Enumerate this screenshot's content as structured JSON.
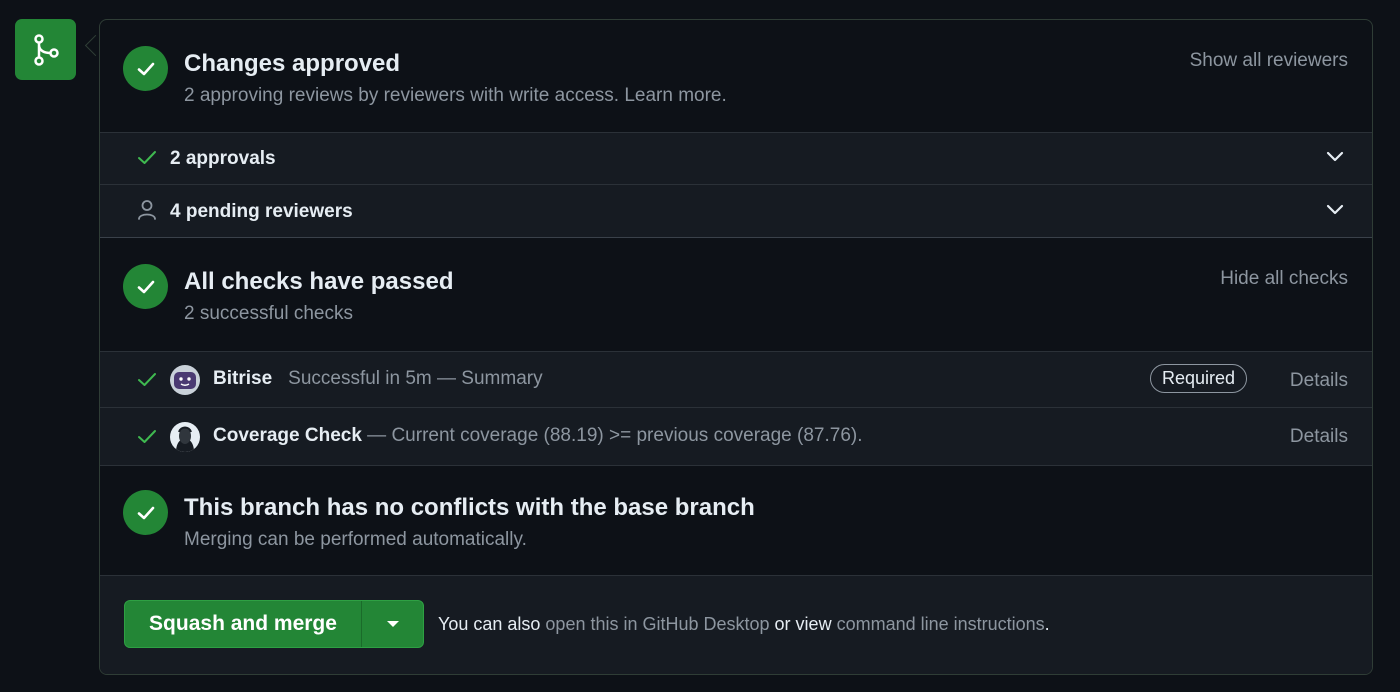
{
  "review": {
    "title": "Changes approved",
    "subtitle": "2 approving reviews by reviewers with write access. Learn more.",
    "action": "Show all reviewers",
    "rows": [
      {
        "label": "2 approvals"
      },
      {
        "label": "4 pending reviewers"
      }
    ]
  },
  "checks": {
    "title": "All checks have passed",
    "subtitle": "2 successful checks",
    "action": "Hide all checks",
    "items": [
      {
        "name": "Bitrise",
        "description": "Successful in 5m — Summary",
        "badge": "Required",
        "details": "Details"
      },
      {
        "name": "Coverage Check",
        "description": " — Current coverage (88.19) >= previous coverage (87.76).",
        "details": "Details"
      }
    ]
  },
  "conflicts": {
    "title": "This branch has no conflicts with the base branch",
    "subtitle": "Merging can be performed automatically."
  },
  "merge": {
    "button_label": "Squash and merge",
    "text_prefix": "You can also ",
    "link_desktop": "open this in GitHub Desktop",
    "text_middle": " or view ",
    "link_cli": "command line instructions",
    "text_suffix": "."
  },
  "colors": {
    "success": "#238636",
    "background": "#0d1117",
    "muted": "#8d96a0"
  }
}
